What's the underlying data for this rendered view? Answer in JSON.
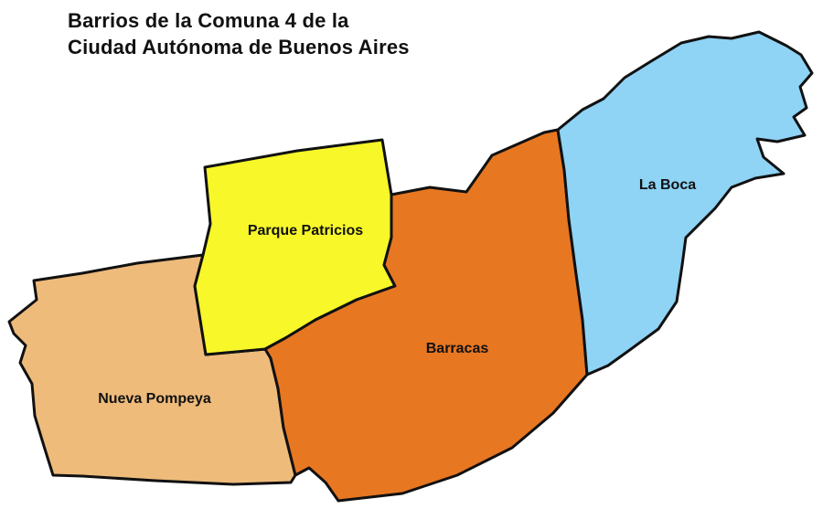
{
  "title": {
    "line1": "Barrios de la Comuna 4 de la",
    "line2": "Ciudad Autónoma de Buenos Aires"
  },
  "districts": [
    {
      "id": "la-boca",
      "label": "La Boca",
      "color": "#8fd3f5"
    },
    {
      "id": "barracas",
      "label": "Barracas",
      "color": "#e87722"
    },
    {
      "id": "parque-patricios",
      "label": "Parque Patricios",
      "color": "#f7f72a"
    },
    {
      "id": "nueva-pompeya",
      "label": "Nueva Pompeya",
      "color": "#eebb7b"
    }
  ],
  "border_color": "#111111"
}
